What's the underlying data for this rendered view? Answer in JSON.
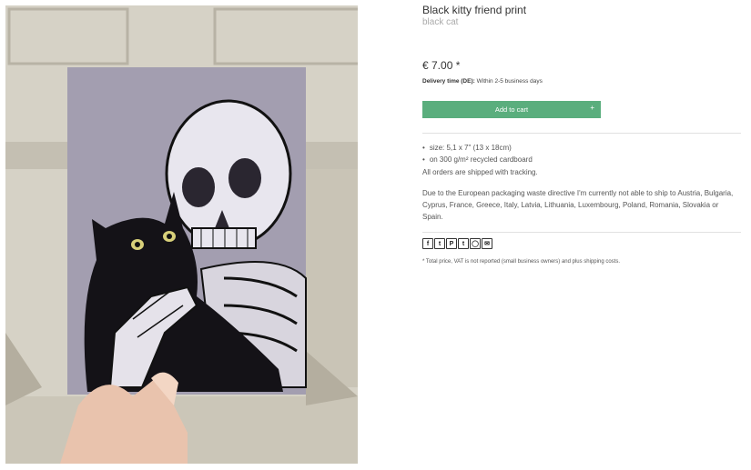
{
  "product": {
    "title": "Black kitty friend print",
    "subtitle": "black cat",
    "price": "€ 7.00 *",
    "delivery_label": "Delivery time (DE):",
    "delivery_value": "Within 2-5 business days",
    "add_to_cart_label": "Add to cart",
    "add_to_cart_plus": "+",
    "specs": [
      "size: 5,1 x 7\" (13 x 18cm)",
      "on 300 g/m² recycled cardboard"
    ],
    "shipping_note": "All orders are shipped with tracking.",
    "shipping_restriction": "Due to the European packaging waste directive I'm currently not able to ship to Austria, Bulgaria, Cyprus, France, Greece, Italy, Latvia, Lithuania, Luxembourg, Poland, Romania, Slovakia or Spain.",
    "footnote": "* Total price, VAT is not reported (small business owners) and plus shipping costs."
  },
  "share_icons": [
    {
      "name": "facebook-icon",
      "glyph": "f"
    },
    {
      "name": "twitter-icon",
      "glyph": "t"
    },
    {
      "name": "pinterest-icon",
      "glyph": "P"
    },
    {
      "name": "tumblr-icon",
      "glyph": "t"
    },
    {
      "name": "whatsapp-icon",
      "glyph": "◯"
    },
    {
      "name": "email-icon",
      "glyph": "✉"
    }
  ],
  "colors": {
    "button": "#5aae7d",
    "card_background": "#a39eb0"
  }
}
